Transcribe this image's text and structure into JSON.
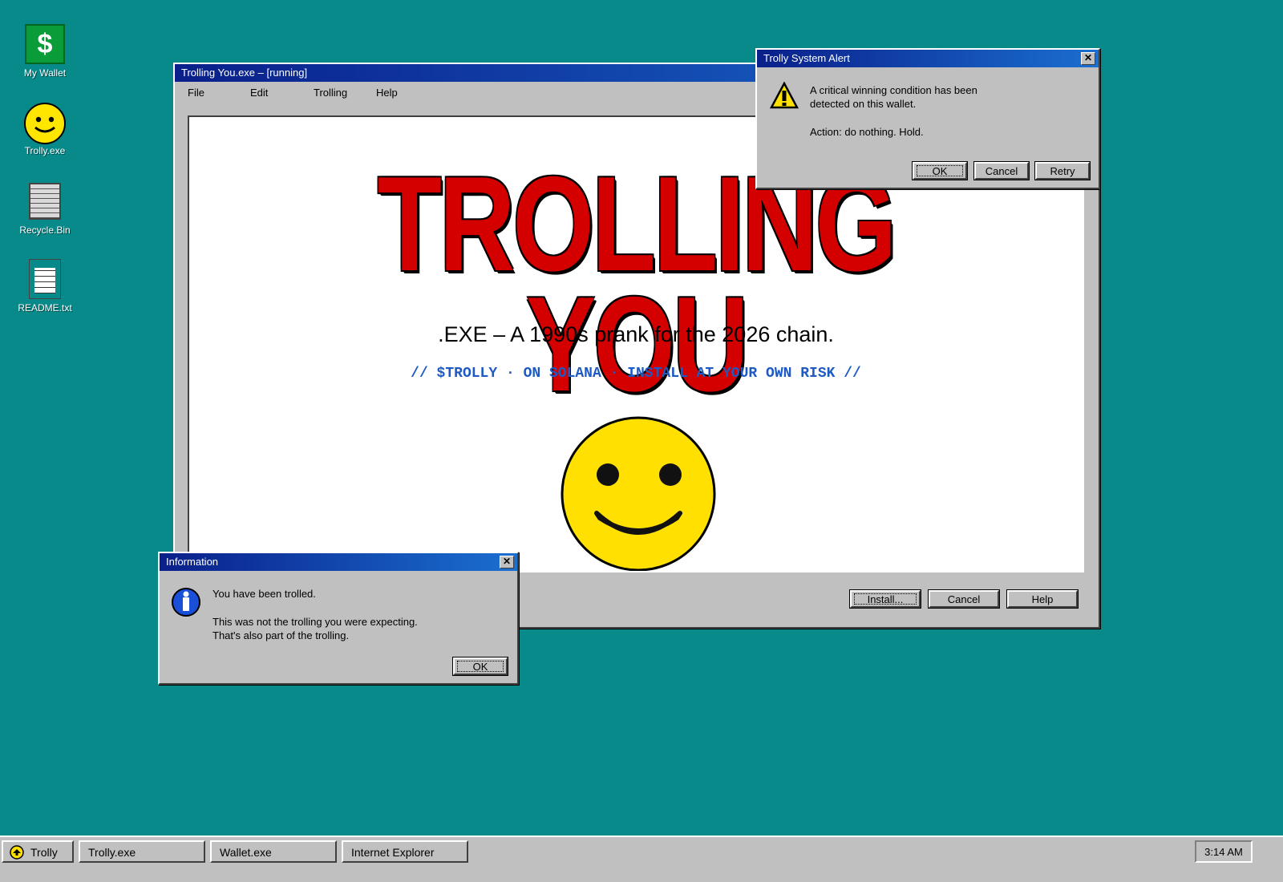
{
  "desktop": {
    "icons": [
      {
        "label": "My Wallet",
        "icon": "dollar-icon"
      },
      {
        "label": "Trolly.exe",
        "icon": "smiley-icon"
      },
      {
        "label": "Recycle.Bin",
        "icon": "recycle-bin-icon"
      },
      {
        "label": "README.txt",
        "icon": "text-file-icon"
      }
    ],
    "background_color": "#088a8a"
  },
  "main_window": {
    "title": "Trolling You.exe – [running]",
    "menu": [
      "File",
      "Edit",
      "Trolling",
      "Help"
    ],
    "headline": "TROLLING YOU",
    "subline": ".EXE – A 1990s prank for the 2026 chain.",
    "tagline": "// $TROLLY · ON SOLANA · INSTALL AT YOUR OWN RISK //",
    "buttons": {
      "install": "Install...",
      "cancel": "Cancel",
      "help": "Help"
    },
    "headline_color": "#d40000",
    "tagline_color": "#1d5ac4"
  },
  "alert_dialog": {
    "title": "Trolly System Alert",
    "close": "✕",
    "line1": "A critical winning condition has been",
    "line2": "detected on this wallet.",
    "line3": "Action: do nothing. Hold.",
    "buttons": {
      "ok": "OK",
      "cancel": "Cancel",
      "retry": "Retry"
    },
    "icon": "warning-icon"
  },
  "info_dialog": {
    "title": "Information",
    "close": "✕",
    "line1": "You have been trolled.",
    "line2": "This was not the trolling you were expecting.",
    "line3": "That's also part of the trolling.",
    "ok": "OK",
    "icon": "info-icon"
  },
  "taskbar": {
    "start_label": "Trolly",
    "tasks": [
      "Trolly.exe",
      "Wallet.exe",
      "Internet Explorer"
    ],
    "clock": "3:14 AM"
  }
}
